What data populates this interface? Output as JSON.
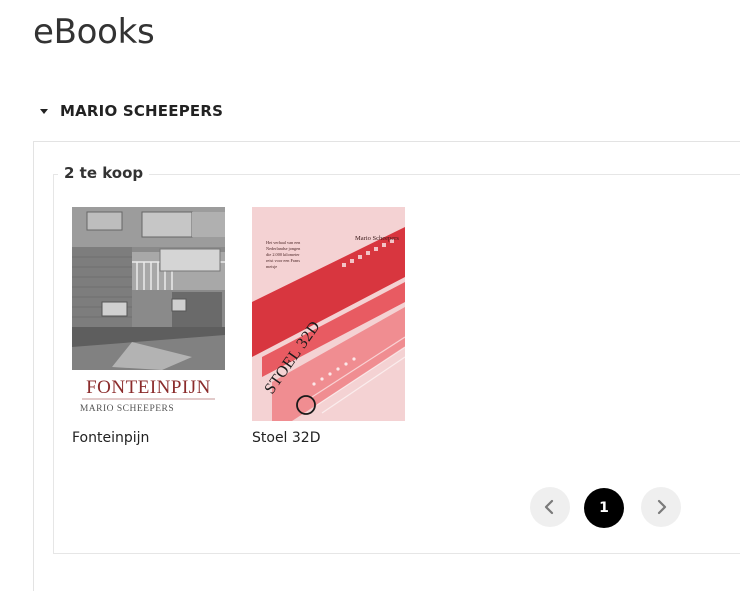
{
  "page": {
    "title": "eBooks"
  },
  "section": {
    "title": "MARIO SCHEEPERS",
    "expanded": true
  },
  "listing": {
    "count_label": "2 te koop",
    "books": [
      {
        "title": "Fonteinpijn",
        "cover_title": "FONTEINPIJN",
        "cover_author": "MARIO SCHEEPERS"
      },
      {
        "title": "Stoel 32D",
        "cover_title": "STOEL 32D",
        "cover_author": "Mario Scheepers",
        "cover_tagline": "Het verhaal van een Nederlandse jongen die 2.000 kilometer reist voor een Frans meisje"
      }
    ]
  },
  "pagination": {
    "prev_icon": "chevron-left-icon",
    "current_page": "1",
    "next_icon": "chevron-right-icon"
  },
  "colors": {
    "pager_active_bg": "#000000",
    "pager_inactive_bg": "#efefef",
    "stoel_cover_red": "#d8363f"
  }
}
